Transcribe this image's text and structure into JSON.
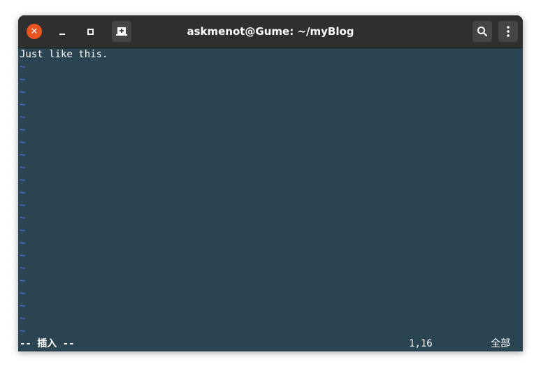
{
  "window": {
    "title": "askmenot@Gume: ~/myBlog"
  },
  "titlebar": {
    "buttons": [
      {
        "name": "close",
        "icon": "close-icon"
      },
      {
        "name": "minimize",
        "icon": "minimize-icon"
      },
      {
        "name": "maximize",
        "icon": "maximize-icon"
      },
      {
        "name": "new-tab",
        "icon": "new-tab-icon"
      },
      {
        "name": "search",
        "icon": "search-icon"
      },
      {
        "name": "menu",
        "icon": "kebab-menu-icon"
      }
    ]
  },
  "editor": {
    "lines": [
      "Just like this."
    ],
    "empty_line_marker": "~",
    "empty_line_count": 22
  },
  "statusline": {
    "mode": "-- 插入 --",
    "position": "1,16",
    "scroll": "全部"
  },
  "colors": {
    "background": "#2b4452",
    "titlebar": "#2f2f2f",
    "close_button": "#e95420",
    "tilde": "#4a6fd8",
    "text": "#ffffff"
  }
}
